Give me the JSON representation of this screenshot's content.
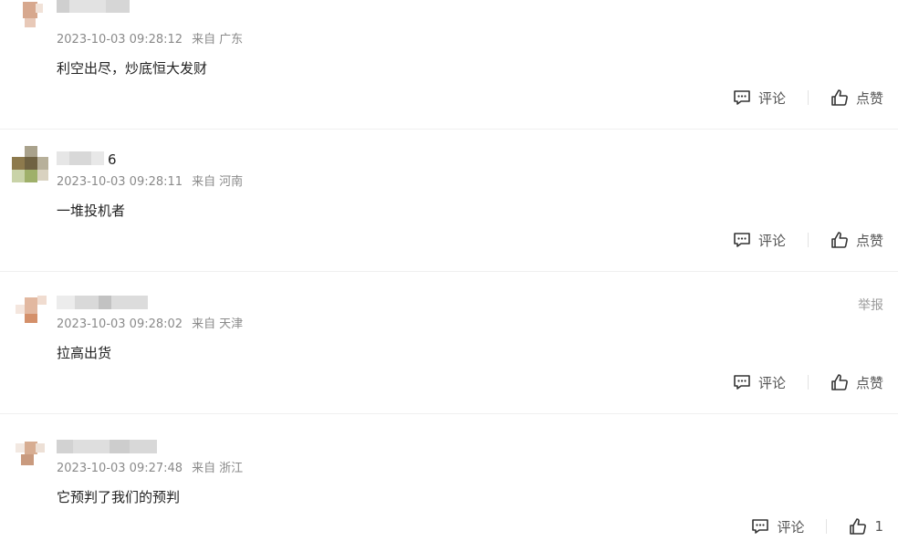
{
  "comments": [
    {
      "username_suffix": "",
      "time": "2023-10-03 09:28:12",
      "from_label": "来自",
      "location": "广东",
      "content": "利空出尽，炒底恒大发财",
      "comment_label": "评论",
      "like_label": "点赞"
    },
    {
      "username_suffix": "6",
      "time": "2023-10-03 09:28:11",
      "from_label": "来自",
      "location": "河南",
      "content": "一堆投机者",
      "comment_label": "评论",
      "like_label": "点赞"
    },
    {
      "username_suffix": "",
      "time": "2023-10-03 09:28:02",
      "from_label": "来自",
      "location": "天津",
      "content": "拉高出货",
      "comment_label": "评论",
      "like_label": "点赞",
      "report_label": "举报"
    },
    {
      "username_suffix": "",
      "time": "2023-10-03 09:27:48",
      "from_label": "来自",
      "location": "浙江",
      "content": "它预判了我们的预判",
      "comment_label": "评论",
      "like_label": "1"
    }
  ],
  "icons": {
    "comment": "comment-icon",
    "like": "thumbs-up-icon"
  },
  "colors": {
    "text": "#222222",
    "meta": "#8a8a8a",
    "action": "#555555",
    "divider": "#f0f0f0"
  }
}
